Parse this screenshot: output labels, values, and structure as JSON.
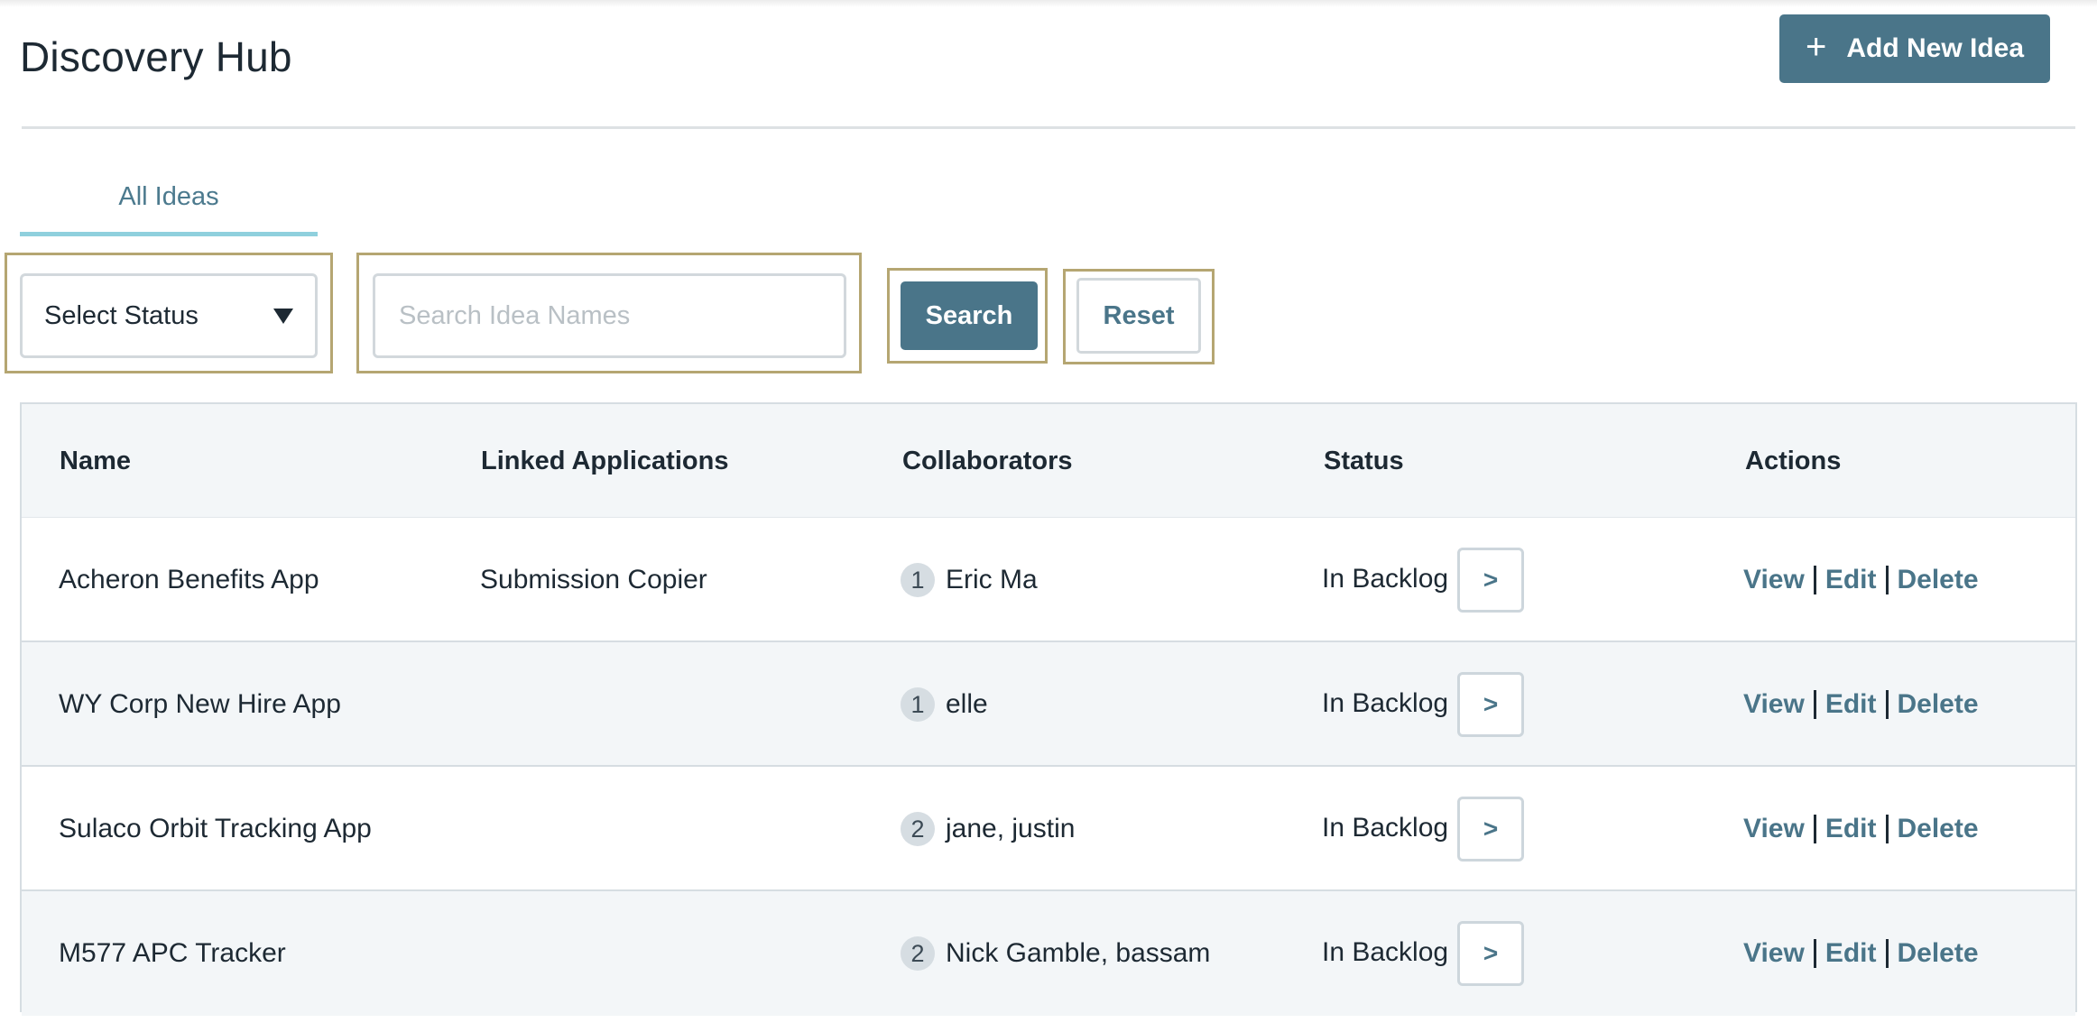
{
  "header": {
    "title": "Discovery Hub",
    "add_button_label": "Add New Idea",
    "add_button_icon": "plus-icon"
  },
  "tabs": [
    {
      "label": "All Ideas",
      "active": true
    }
  ],
  "filters": {
    "status_select": {
      "value": "Select Status",
      "icon": "caret-down-icon"
    },
    "search": {
      "value": "",
      "placeholder": "Search Idea Names"
    },
    "search_button_label": "Search",
    "reset_button_label": "Reset"
  },
  "table": {
    "columns": [
      "Name",
      "Linked Applications",
      "Collaborators",
      "Status",
      "Actions"
    ],
    "rows": [
      {
        "name": "Acheron Benefits App",
        "linked": "Submission Copier",
        "collab_count": "1",
        "collaborators": "Eric Ma",
        "status": "In Backlog",
        "advance": ">",
        "view": "View",
        "edit": "Edit",
        "delete": "Delete"
      },
      {
        "name": "WY Corp New Hire App",
        "linked": "",
        "collab_count": "1",
        "collaborators": "elle",
        "status": "In Backlog",
        "advance": ">",
        "view": "View",
        "edit": "Edit",
        "delete": "Delete"
      },
      {
        "name": "Sulaco Orbit Tracking App",
        "linked": "",
        "collab_count": "2",
        "collaborators": "jane, justin",
        "status": "In Backlog",
        "advance": ">",
        "view": "View",
        "edit": "Edit",
        "delete": "Delete"
      },
      {
        "name": "M577 APC Tracker",
        "linked": "",
        "collab_count": "2",
        "collaborators": "Nick Gamble, bassam",
        "status": "In Backlog",
        "advance": ">",
        "view": "View",
        "edit": "Edit",
        "delete": "Delete"
      }
    ]
  },
  "colors": {
    "primary": "#4a7589",
    "tab_underline": "#8fd0dd",
    "highlight_border": "#b5a672",
    "header_row_bg": "#f3f6f8"
  }
}
